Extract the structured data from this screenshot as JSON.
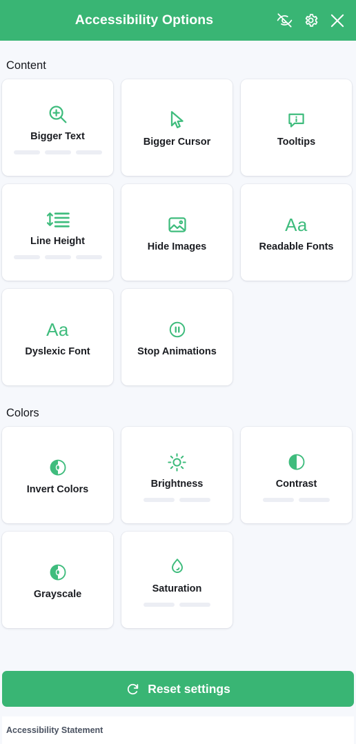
{
  "header": {
    "title": "Accessibility Options",
    "actions": [
      {
        "name": "hide-eye-icon",
        "label": "Hide"
      },
      {
        "name": "gear-icon",
        "label": "Settings"
      },
      {
        "name": "close-icon",
        "label": "Close"
      }
    ]
  },
  "accent_color": "#39b574",
  "background_color": "#f6f8fc",
  "card_color": "#ffffff",
  "sections": [
    {
      "title": "Content",
      "cards": [
        {
          "label": "Bigger Text",
          "icon": "zoom-in-icon",
          "levels": 3,
          "active_levels": 0
        },
        {
          "label": "Bigger Cursor",
          "icon": "cursor-icon",
          "levels": 0,
          "active_levels": 0
        },
        {
          "label": "Tooltips",
          "icon": "tooltip-info-icon",
          "levels": 0,
          "active_levels": 0
        },
        {
          "label": "Line Height",
          "icon": "line-height-icon",
          "levels": 3,
          "active_levels": 0
        },
        {
          "label": "Hide Images",
          "icon": "image-icon",
          "levels": 0,
          "active_levels": 0
        },
        {
          "label": "Readable Fonts",
          "icon": "font-aa-icon",
          "levels": 0,
          "active_levels": 0
        },
        {
          "label": "Dyslexic Font",
          "icon": "font-aa-icon",
          "levels": 0,
          "active_levels": 0
        },
        {
          "label": "Stop Animations",
          "icon": "pause-circle-icon",
          "levels": 0,
          "active_levels": 0
        }
      ]
    },
    {
      "title": "Colors",
      "cards": [
        {
          "label": "Invert Colors",
          "icon": "invert-circle-icon",
          "levels": 0,
          "active_levels": 0
        },
        {
          "label": "Brightness",
          "icon": "sun-icon",
          "levels": 2,
          "active_levels": 0
        },
        {
          "label": "Contrast",
          "icon": "contrast-circle-icon",
          "levels": 2,
          "active_levels": 0
        },
        {
          "label": "Grayscale",
          "icon": "invert-circle-icon",
          "levels": 0,
          "active_levels": 0
        },
        {
          "label": "Saturation",
          "icon": "droplet-icon",
          "levels": 2,
          "active_levels": 0
        }
      ]
    }
  ],
  "footer": {
    "reset_label": "Reset settings",
    "reset_icon": "refresh-icon",
    "statement_label": "Accessibility Statement"
  }
}
